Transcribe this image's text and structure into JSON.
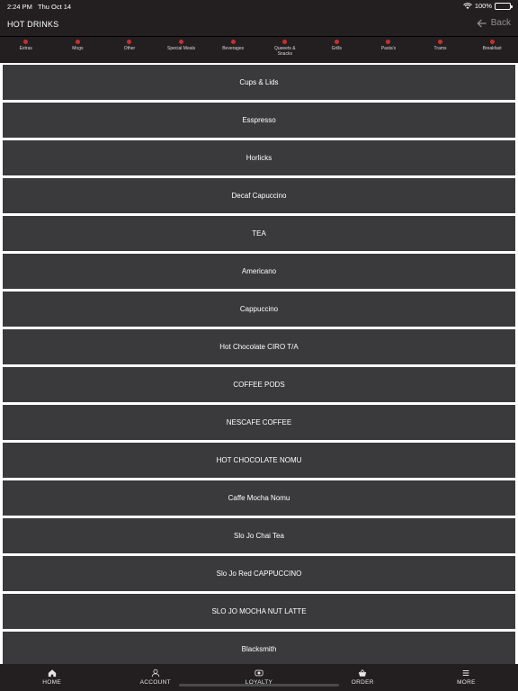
{
  "status": {
    "time": "2:24 PM",
    "date": "Thu Oct 14",
    "battery": "100%",
    "wifi_icon": "wifi-icon",
    "battery_icon": "battery-icon"
  },
  "header": {
    "title": "HOT DRINKS",
    "back_label": "Back",
    "back_icon": "arrow-left-icon"
  },
  "categories": [
    {
      "label": "Extras"
    },
    {
      "label": "Mogs"
    },
    {
      "label": "Other"
    },
    {
      "label": "Special Meals"
    },
    {
      "label": "Beverages"
    },
    {
      "label": "Queeets & Snacks"
    },
    {
      "label": "Grills"
    },
    {
      "label": "Pasta's"
    },
    {
      "label": "Trams"
    },
    {
      "label": "Breakfast"
    }
  ],
  "items": [
    {
      "label": "Cups & Lids"
    },
    {
      "label": "Esspresso"
    },
    {
      "label": "Horlicks"
    },
    {
      "label": "Decaf Capuccino"
    },
    {
      "label": "TEA"
    },
    {
      "label": "Americano"
    },
    {
      "label": "Cappuccino"
    },
    {
      "label": "Hot Chocolate CIRO T/A"
    },
    {
      "label": "COFFEE PODS"
    },
    {
      "label": "NESCAFE COFFEE"
    },
    {
      "label": "HOT CHOCOLATE NOMU"
    },
    {
      "label": "Caffe Mocha Nomu"
    },
    {
      "label": "Slo Jo Chai Tea"
    },
    {
      "label": "Slo Jo Red CAPPUCCINO"
    },
    {
      "label": "SLO JO MOCHA NUT LATTE"
    },
    {
      "label": "Blacksmith"
    }
  ],
  "tabs": [
    {
      "label": "HOME",
      "icon": "home-icon"
    },
    {
      "label": "ACCOUNT",
      "icon": "user-icon"
    },
    {
      "label": "LOYALTY",
      "icon": "loyalty-icon"
    },
    {
      "label": "ORDER",
      "icon": "basket-icon"
    },
    {
      "label": "MORE",
      "icon": "menu-icon"
    }
  ],
  "colors": {
    "bar_bg": "#231f20",
    "item_bg": "#3a3a3c",
    "category_dot": "#c7302c"
  }
}
